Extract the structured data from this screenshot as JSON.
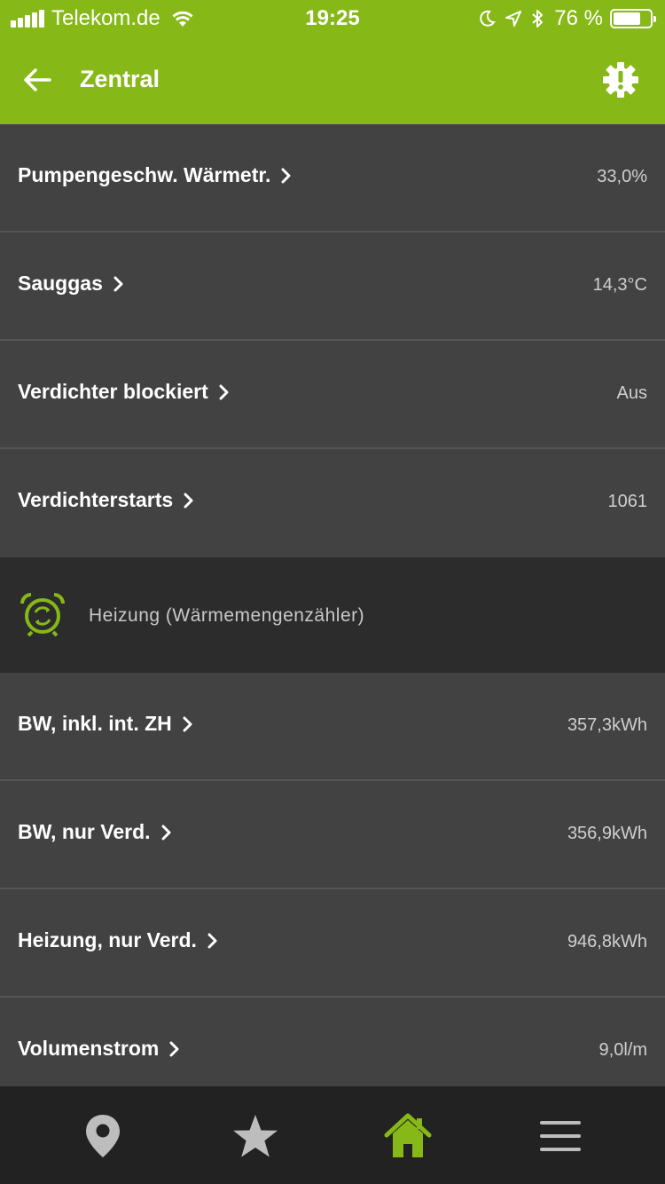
{
  "status_bar": {
    "carrier": "Telekom.de",
    "time": "19:25",
    "battery_percent": "76 %",
    "battery_level": 0.76,
    "icons": [
      "signal-icon",
      "wifi-icon",
      "moon-icon",
      "location-icon",
      "bluetooth-icon",
      "battery-icon"
    ]
  },
  "header": {
    "title": "Zentral",
    "back_icon": "arrow-left-icon",
    "settings_icon": "gear-alert-icon"
  },
  "rows_top": [
    {
      "label": "Pumpengeschw. Wärmetr.",
      "value": "33,0%"
    },
    {
      "label": "Sauggas",
      "value": "14,3°C"
    },
    {
      "label": "Verdichter blockiert",
      "value": "Aus"
    },
    {
      "label": "Verdichterstarts",
      "value": "1061"
    }
  ],
  "section": {
    "title": "Heizung (Wärmemengenzähler)",
    "icon": "cycle-alarm-icon"
  },
  "rows_bottom": [
    {
      "label": "BW, inkl. int. ZH",
      "value": "357,3kWh"
    },
    {
      "label": "BW, nur Verd.",
      "value": "356,9kWh"
    },
    {
      "label": "Heizung, nur Verd.",
      "value": "946,8kWh"
    },
    {
      "label": "Volumenstrom",
      "value": "9,0l/m"
    }
  ],
  "tab_bar": {
    "tabs": [
      {
        "icon": "location-pin-icon",
        "active": false
      },
      {
        "icon": "star-icon",
        "active": false
      },
      {
        "icon": "home-icon",
        "active": true
      },
      {
        "icon": "menu-icon",
        "active": false
      }
    ]
  },
  "colors": {
    "accent": "#86b817",
    "row_bg": "#424242",
    "section_bg": "#2c2c2c",
    "tabbar_bg": "#222222",
    "inactive_icon": "#bdbdbd"
  }
}
